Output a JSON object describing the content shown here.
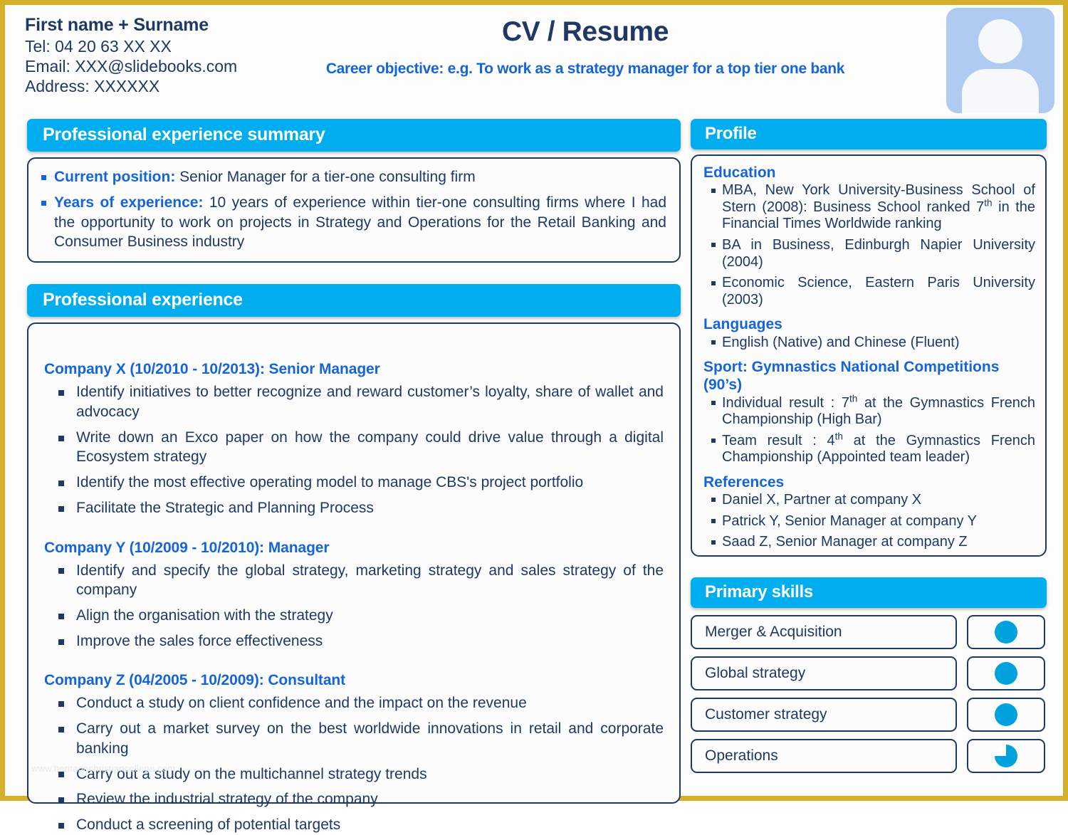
{
  "document": {
    "title": "CV / Resume",
    "career_objective": "Career objective: e.g. To work as a strategy manager for a top tier one bank",
    "watermark": "www.heritagechristiancollege.com"
  },
  "contact": {
    "name": "First name + Surname",
    "phone": "Tel: 04 20 63 XX XX",
    "email": "Email: XXX@slidebooks.com",
    "address": "Address: XXXXXX"
  },
  "avatar": {
    "icon": "person-avatar-icon"
  },
  "summary": {
    "header": "Professional experience summary",
    "items": [
      {
        "label": "Current position:",
        "text": " Senior Manager for a tier-one consulting firm"
      },
      {
        "label": "Years of experience:",
        "text": " 10 years of experience within tier-one consulting firms where I had the opportunity to work on projects in Strategy and Operations for the Retail Banking and Consumer Business industry"
      }
    ]
  },
  "experience": {
    "header": "Professional experience",
    "companies": [
      {
        "heading": "Company X (10/2010 - 10/2013):  Senior Manager",
        "bullets": [
          "Identify initiatives to better recognize and reward customer’s loyalty, share of wallet and advocacy",
          "Write down an Exco paper on how the company could drive value through a digital Ecosystem strategy",
          "Identify the most effective operating model to manage CBS's project portfolio",
          "Facilitate the Strategic and Planning Process"
        ]
      },
      {
        "heading": "Company Y (10/2009 - 10/2010):  Manager",
        "bullets": [
          "Identify and specify the global strategy, marketing strategy and sales strategy of the company",
          "Align the organisation with the strategy",
          "Improve the sales force effectiveness"
        ]
      },
      {
        "heading": "Company Z (04/2005 - 10/2009): Consultant",
        "bullets": [
          "Conduct a study on client confidence and the impact on the revenue",
          "Carry out a market survey on the best worldwide innovations in retail and corporate banking",
          "Carry out a study on the multichannel strategy trends",
          "Review the industrial strategy of the company",
          "Conduct a screening of potential targets"
        ]
      }
    ]
  },
  "profile": {
    "header": "Profile",
    "education": {
      "label": "Education",
      "items": [
        "MBA, New York University-Business School of Stern (2008): Business School ranked 7<sup>th</sup> in the Financial Times Worldwide ranking",
        "BA in Business, Edinburgh Napier University (2004)",
        "Economic Science, Eastern Paris University (2003)"
      ]
    },
    "languages": {
      "label": "Languages",
      "items": [
        "English (Native) and Chinese (Fluent)"
      ]
    },
    "sport": {
      "label": "Sport: Gymnastics National Competitions (90’s)",
      "items": [
        "Individual result : 7<sup>th</sup> at the Gymnastics French Championship (High Bar)",
        "Team result : 4<sup>th</sup> at the Gymnastics French Championship (Appointed team leader)"
      ]
    },
    "references": {
      "label": "References",
      "items": [
        "Daniel X, Partner at company X",
        "Patrick Y, Senior Manager at company Y",
        "Saad Z, Senior Manager at company Z"
      ]
    }
  },
  "skills": {
    "header": "Primary skills",
    "items": [
      {
        "name": "Merger & Acquisition",
        "level": 100
      },
      {
        "name": "Global strategy",
        "level": 100
      },
      {
        "name": "Customer strategy",
        "level": 100
      },
      {
        "name": "Operations",
        "level": 75
      }
    ]
  },
  "colors": {
    "bar_blue": "#00ADEF",
    "accent_blue": "#1565D8",
    "navy": "#1F3864",
    "dial_blue": "#00A2DD",
    "page_border": "#D4B02A",
    "avatar_bg": "#AFCBF2"
  }
}
